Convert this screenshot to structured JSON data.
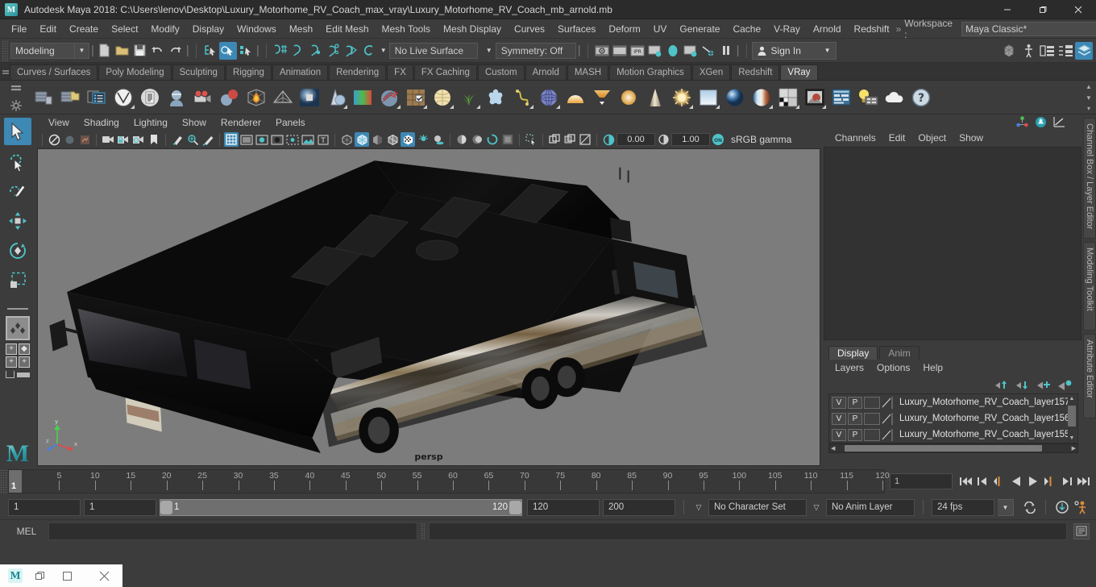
{
  "titlebar": {
    "app_icon": "maya-logo-icon",
    "title": "Autodesk Maya 2018: C:\\Users\\lenov\\Desktop\\Luxury_Motorhome_RV_Coach_max_vray\\Luxury_Motorhome_RV_Coach_mb_arnold.mb",
    "minimize": "minimize-icon",
    "maximize": "restore-icon",
    "close": "close-icon"
  },
  "menubar": {
    "items": [
      "File",
      "Edit",
      "Create",
      "Select",
      "Modify",
      "Display",
      "Windows",
      "Mesh",
      "Edit Mesh",
      "Mesh Tools",
      "Mesh Display",
      "Curves",
      "Surfaces",
      "Deform",
      "UV",
      "Generate",
      "Cache",
      "V-Ray",
      "Arnold",
      "Redshift"
    ],
    "overflow": "»",
    "workspace_label": "Workspace :",
    "workspace_value": "Maya Classic*",
    "lock_icon": "lock-icon"
  },
  "statusbar": {
    "mode": "Modeling",
    "file_icons": [
      "new-scene-icon",
      "open-scene-icon",
      "save-scene-icon",
      "undo-icon",
      "redo-icon"
    ],
    "select_mode_icons": [
      "select-by-hierarchy-icon",
      "select-by-object-icon",
      "select-by-component-icon"
    ],
    "snap_icons": [
      "snap-to-grid-icon",
      "snap-to-curve-icon",
      "snap-to-point-icon",
      "snap-to-projected-center-icon",
      "snap-to-view-plane-icon",
      "make-live-icon"
    ],
    "live_surface": "No Live Surface",
    "symmetry": "Symmetry: Off",
    "render_icons": [
      "render-current-frame-icon",
      "render-sequence-icon",
      "ipr-render-icon",
      "render-settings-icon",
      "hypershade-icon",
      "render-view-icon",
      "light-editor-icon",
      "pause-icon"
    ],
    "sign_in": "Sign In",
    "right_icons": [
      "modeling-toolkit-icon",
      "hud-icon",
      "channel-box-icon",
      "attribute-editor-icon",
      "layer-editor-icon"
    ]
  },
  "shelf": {
    "tabs": [
      "Curves / Surfaces",
      "Poly Modeling",
      "Sculpting",
      "Rigging",
      "Animation",
      "Rendering",
      "FX",
      "FX Caching",
      "Custom",
      "Arnold",
      "MASH",
      "Motion Graphics",
      "XGen",
      "Redshift",
      "VRay"
    ],
    "active_tab": "VRay",
    "icons": [
      "vray-save-render-icon",
      "vray-load-render-icon",
      "vray-render-elements-icon",
      "vray-logo-icon",
      "vray-script-icon",
      "vray-head-material-icon",
      "vray-camera-icon",
      "vray-material-icon",
      "vray-volume-grid-icon",
      "vray-plane-icon",
      "vray-sphere-light-icon",
      "vray-displacement-icon",
      "vray-gradient-icon",
      "vray-decal-icon",
      "vray-sphere-fade-icon",
      "vray-fur-icon",
      "vray-grass-icon",
      "vray-particle-icon",
      "vray-curve-icon",
      "vray-env-sphere-icon",
      "vray-dome-light-icon",
      "vray-rect-light-icon",
      "vray-ies-light-icon",
      "vray-light-mesh-icon",
      "vray-sun-icon",
      "vray-sky-icon",
      "vray-sphere-mat-icon",
      "vray-blend-mat-icon",
      "vray-checker-icon",
      "vray-material-preview-icon",
      "vray-render-settings-icon",
      "vray-light-lister-icon",
      "vray-cloud-icon",
      "vray-help-icon"
    ]
  },
  "toolbox": {
    "tools": [
      "select-tool-icon",
      "lasso-select-tool-icon",
      "paint-select-tool-icon",
      "move-tool-icon",
      "rotate-tool-icon",
      "scale-tool-icon"
    ],
    "active_tool": "select-tool-icon",
    "last_tool": "last-tool-used-icon",
    "layouts": [
      "single-perspective-layout-icon",
      "four-view-layout-icon",
      "outliner-persp-layout-icon"
    ],
    "brand": "M"
  },
  "viewport": {
    "menus": [
      "View",
      "Shading",
      "Lighting",
      "Show",
      "Renderer",
      "Panels"
    ],
    "toolbar_icons": [
      "select-camera-icon",
      "lock-camera-icon",
      "camera-attributes-icon",
      "bookmark-icon",
      "image-plane-icon",
      "grease-pencil-icon",
      "two-d-pan-zoom-icon",
      "grid-icon",
      "film-gate-icon",
      "resolution-gate-icon",
      "gate-mask-icon",
      "film-origin-icon",
      "exposure-icon",
      "xray-icon",
      "wireframe-icon",
      "smooth-shade-all-icon",
      "shade-wireframe-icon",
      "use-default-lights-icon",
      "shadows-icon",
      "screen-space-ao-icon",
      "motion-blur-icon",
      "multisample-icon",
      "isolate-select-icon",
      "xray-joints-icon",
      "xray-active-components-icon",
      "texture-icon",
      "exposure-value",
      "gamma-value",
      "color-management"
    ],
    "exposure_value": "0.00",
    "gamma_value": "1.00",
    "color_profile": "sRGB gamma",
    "camera_label": "persp",
    "background_color": "#7c7c7c",
    "axis_labels": [
      "y",
      "z",
      "x"
    ]
  },
  "channelbox": {
    "top_icons": [
      "show-manipulators-icon",
      "toggle-icon",
      "graph-editor-icon"
    ],
    "menus": [
      "Channels",
      "Edit",
      "Object",
      "Show"
    ],
    "rows": []
  },
  "layereditor": {
    "tabs": [
      "Display",
      "Anim"
    ],
    "active_tab": "Display",
    "menus": [
      "Layers",
      "Options",
      "Help"
    ],
    "buttons": [
      "move-layer-up-icon",
      "move-layer-down-icon",
      "new-layer-icon",
      "new-layer-from-selected-icon"
    ],
    "columns": [
      "V",
      "P",
      "color",
      "render"
    ],
    "layers": [
      {
        "v": "V",
        "p": "P",
        "name": "Luxury_Motorhome_RV_Coach_layer157"
      },
      {
        "v": "V",
        "p": "P",
        "name": "Luxury_Motorhome_RV_Coach_layer156"
      },
      {
        "v": "V",
        "p": "P",
        "name": "Luxury_Motorhome_RV_Coach_layer155"
      }
    ]
  },
  "side_tabs": [
    "Channel Box / Layer Editor",
    "Modeling Toolkit",
    "Attribute Editor"
  ],
  "timeline": {
    "ticks": [
      5,
      10,
      15,
      20,
      25,
      30,
      35,
      40,
      45,
      50,
      55,
      60,
      65,
      70,
      75,
      80,
      85,
      90,
      95,
      100,
      105,
      110,
      115,
      120
    ],
    "current_frame": "1",
    "current_frame_field": "1",
    "playback_buttons": [
      "go-to-start-icon",
      "step-back-keyframe-icon",
      "step-back-frame-icon",
      "play-backwards-icon",
      "play-forwards-icon",
      "step-forward-frame-icon",
      "step-forward-keyframe-icon",
      "go-to-end-icon"
    ]
  },
  "rangebar": {
    "anim_start": "1",
    "range_start": "1",
    "slider_min": "1",
    "slider_max": "120",
    "range_end": "120",
    "anim_end": "200",
    "character_set": "No Character Set",
    "anim_layer": "No Anim Layer",
    "fps": "24 fps",
    "icons": [
      "auto-key-icon",
      "animation-preferences-icon",
      "playback-loop-icon"
    ]
  },
  "commandline": {
    "language": "MEL",
    "input_value": "",
    "output_value": "",
    "help_icon": "help-line-icon"
  },
  "taskbar": {
    "items": [
      "maya-taskbar-icon",
      "restore-window-icon",
      "maximize-window-icon",
      "close-window-icon"
    ]
  },
  "colors": {
    "accent": "#3d88b5",
    "panel_bg": "#3c3c3c",
    "titlebar_bg": "#2b2b2b",
    "viewport_bg": "#7c7c7c",
    "teal": "#4ec3c9",
    "orange": "#e08b36"
  }
}
